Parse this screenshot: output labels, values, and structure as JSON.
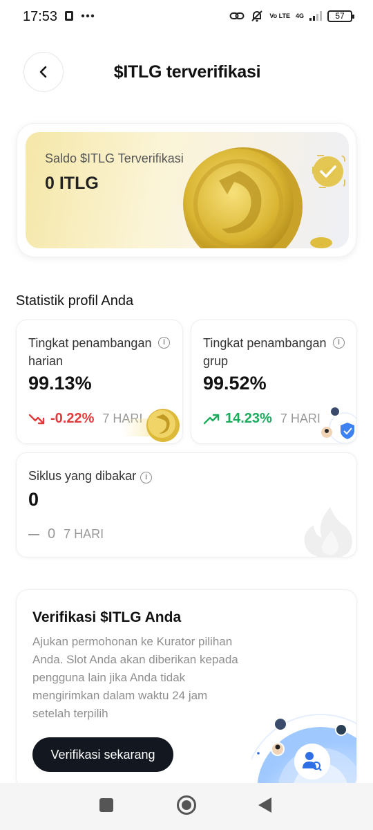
{
  "status_bar": {
    "time": "17:53",
    "network_top": "4G",
    "volte": "Vo LTE",
    "battery": "57"
  },
  "header": {
    "title": "$ITLG terverifikasi",
    "back_icon": "chevron-left-icon"
  },
  "balance": {
    "label": "Saldo $ITLG Terverifikasi",
    "value": "0 ITLG"
  },
  "stats": {
    "section_title": "Statistik profil Anda",
    "daily": {
      "label": "Tingkat penambangan harian",
      "value": "99.13%",
      "change": "-0.22%",
      "days": "7 HARI",
      "trend": "down",
      "trend_color": "#e23a3a"
    },
    "group": {
      "label": "Tingkat penambangan grup",
      "value": "99.52%",
      "change": "14.23%",
      "days": "7 HARI",
      "trend": "up",
      "trend_color": "#1bab5d"
    },
    "burned": {
      "label": "Siklus yang dibakar",
      "value": "0",
      "change": "0",
      "days": "7 HARI"
    }
  },
  "verify": {
    "title": "Verifikasi $ITLG Anda",
    "description": "Ajukan permohonan ke Kurator pilihan Anda. Slot Anda akan diberikan kepada pengguna lain jika Anda tidak mengirimkan dalam waktu 24 jam setelah terpilih",
    "button": "Verifikasi sekarang"
  },
  "colors": {
    "primary_button": "#131820",
    "gold": "#e8c84a"
  }
}
